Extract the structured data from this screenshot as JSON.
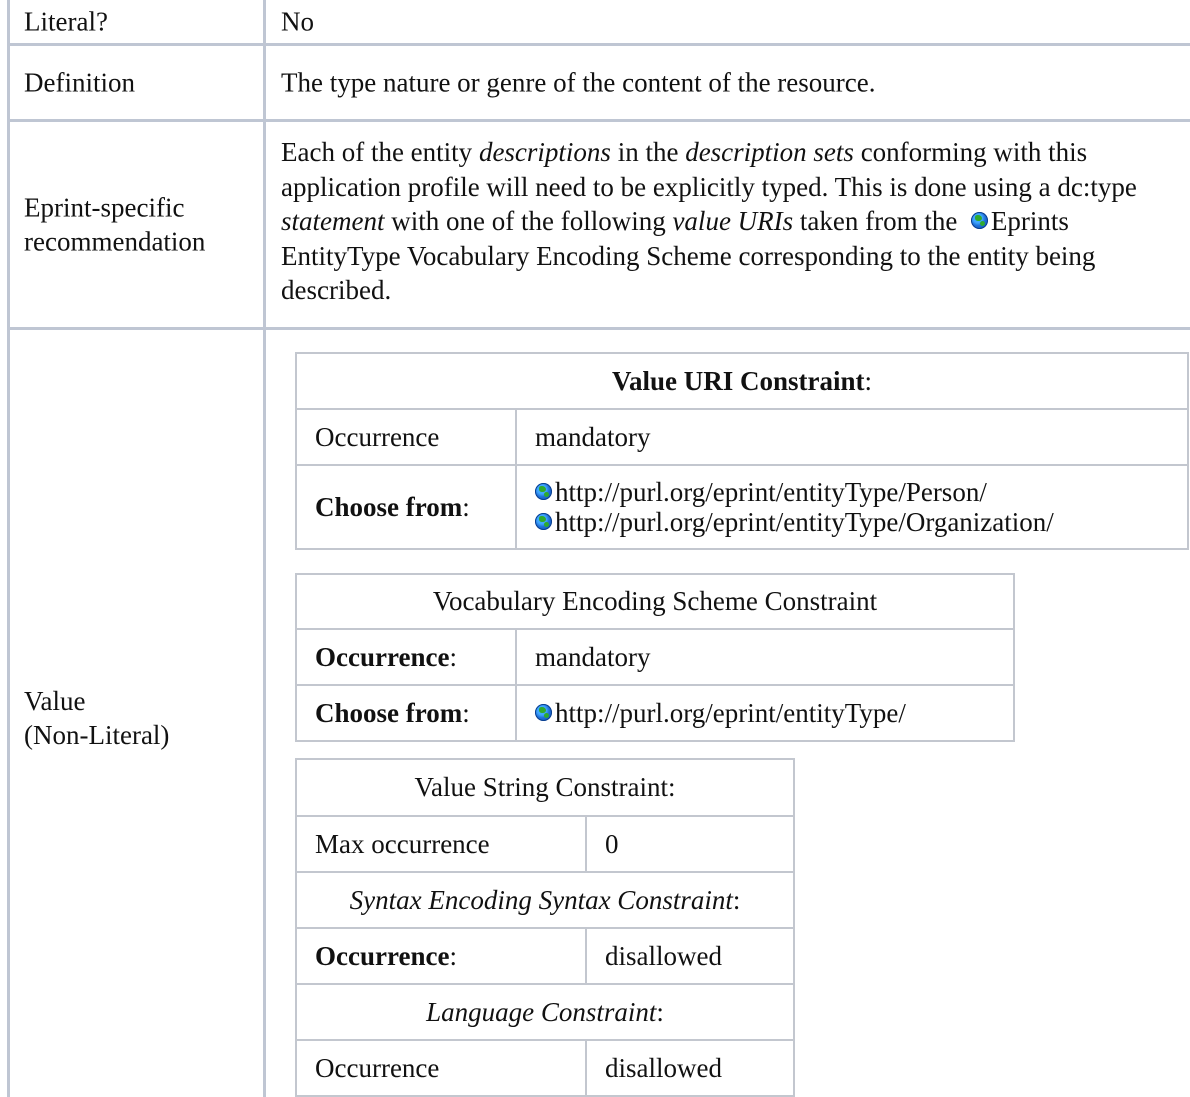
{
  "rows": {
    "literal": {
      "label": "Literal?",
      "value": "No"
    },
    "definition": {
      "label": "Definition",
      "value": "The type nature or genre of the content of the resource."
    },
    "recommendation": {
      "label_line1": "Eprint-specific",
      "label_line2": "recommendation",
      "text_1": "Each of the entity ",
      "em_1": "descriptions",
      "text_2": " in the ",
      "em_2": "description sets",
      "text_3": " conforming with this application profile will need to be explicitly typed. This is done using a dc:type ",
      "em_3": "statement",
      "text_4": " with one of the following ",
      "em_4": "value URIs",
      "text_5": " taken from the ",
      "link": "Eprints EntityType Vocabulary Encoding Scheme",
      "text_6": " corresponding to the entity being described."
    },
    "value_nonliteral": {
      "label_line1": "Value",
      "label_line2": "(Non-Literal)"
    }
  },
  "value_uri_constraint": {
    "title": "Value URI Constraint",
    "title_suffix": ":",
    "occurrence_label": "Occurrence",
    "occurrence_value": "mandatory",
    "choose_label": "Choose from",
    "choose_suffix": ":",
    "uris": [
      "http://purl.org/eprint/entityType/Person/",
      "http://purl.org/eprint/entityType/Organization/"
    ]
  },
  "ves_constraint": {
    "title": "Vocabulary Encoding Scheme Constraint",
    "occurrence_label": "Occurrence",
    "occurrence_suffix": ":",
    "occurrence_value": "mandatory",
    "choose_label": "Choose from",
    "choose_suffix": ":",
    "uri": "http://purl.org/eprint/entityType/"
  },
  "value_string_constraint": {
    "title": "Value String Constraint:",
    "max_occurrence_label": "Max occurrence",
    "max_occurrence_value": "0",
    "syntax_title": "Syntax Encoding Syntax Constraint",
    "syntax_suffix": ":",
    "syntax_occurrence_label": "Occurrence",
    "syntax_occurrence_suffix": ":",
    "syntax_occurrence_value": "disallowed",
    "language_title": "Language Constraint",
    "language_suffix": ":",
    "language_occurrence_label": "Occurrence",
    "language_occurrence_value": "disallowed"
  },
  "icons": {
    "link_icon": "globe-icon"
  }
}
